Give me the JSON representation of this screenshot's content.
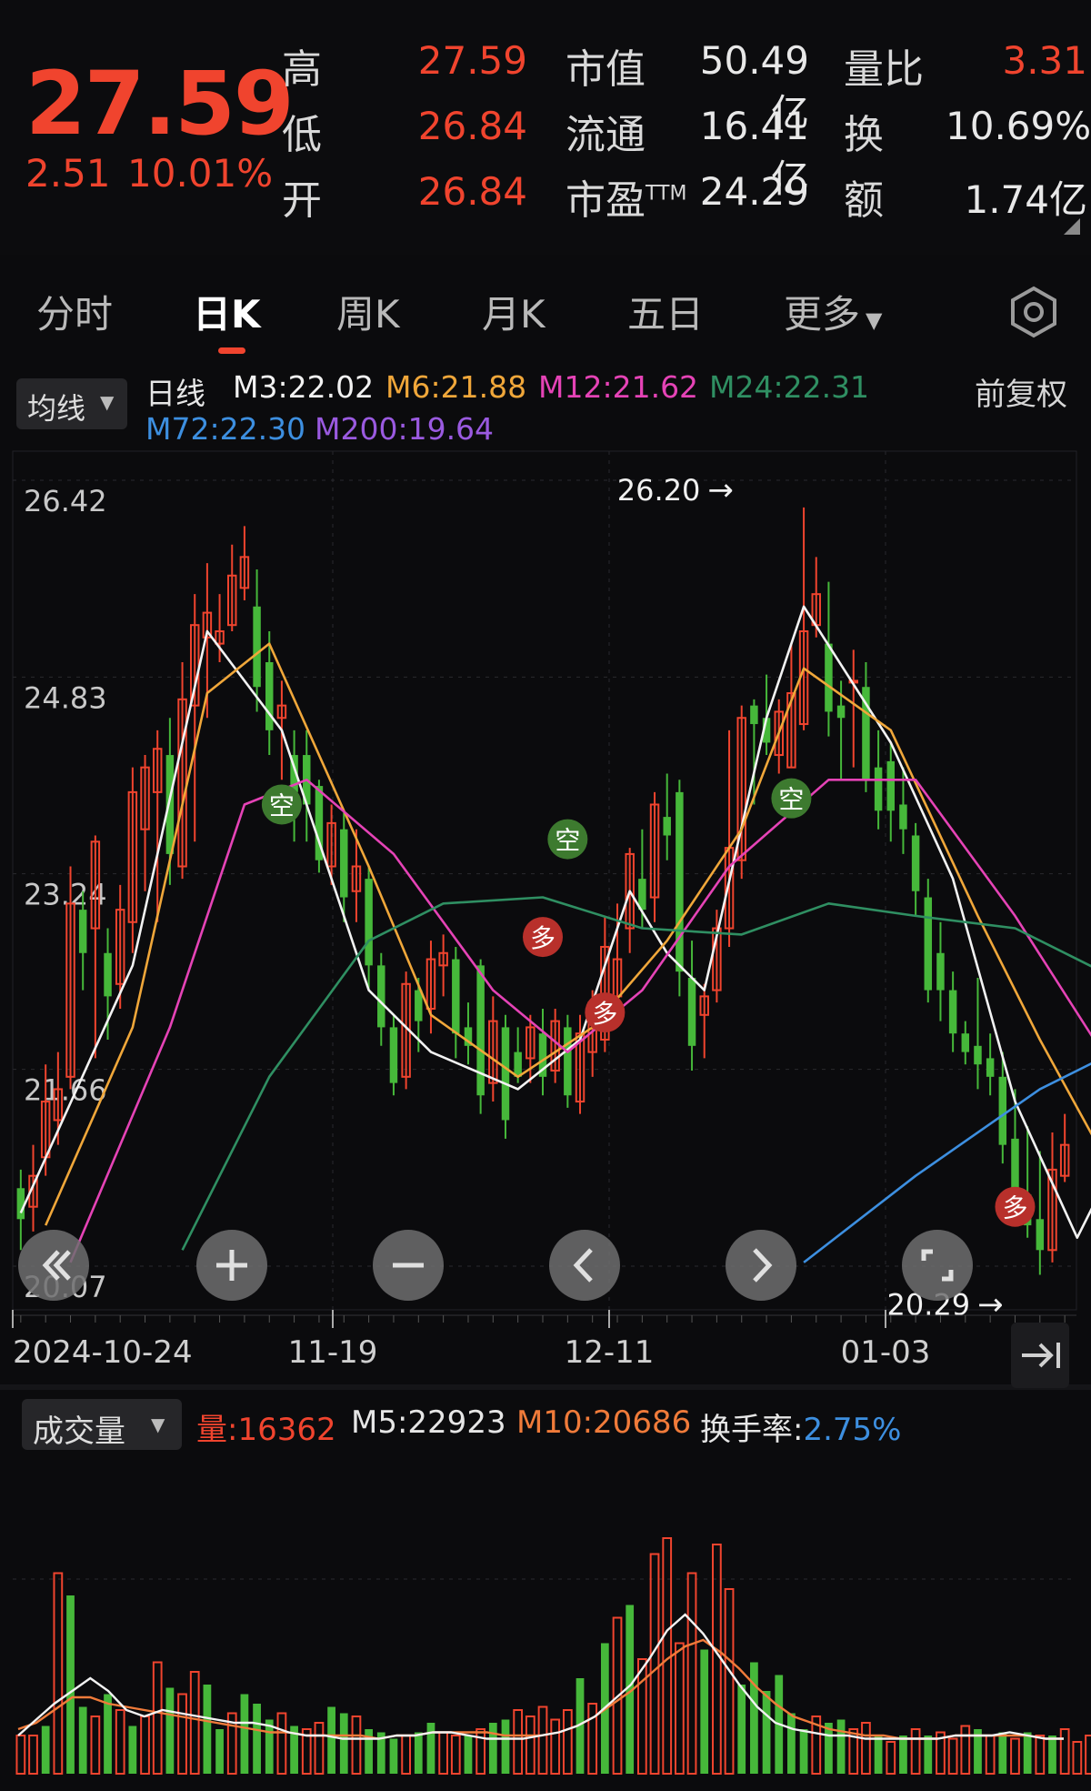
{
  "header": {
    "price": "27.59",
    "change_abs": "2.51",
    "change_pct": "10.01%",
    "stats": [
      {
        "label": "高",
        "value": "27.59",
        "red": true
      },
      {
        "label": "低",
        "value": "26.84",
        "red": true
      },
      {
        "label": "开",
        "value": "26.84",
        "red": true
      }
    ],
    "mid_stats": [
      {
        "label": "市值",
        "value": "50.49亿"
      },
      {
        "label": "流通",
        "value": "16.41亿"
      },
      {
        "label": "市盈",
        "sup": "TTM",
        "value": "24.29"
      }
    ],
    "right_stats": [
      {
        "label": "量比",
        "value": "3.31",
        "red": true
      },
      {
        "label": "换",
        "value": "10.69%"
      },
      {
        "label": "额",
        "value": "1.74亿"
      }
    ]
  },
  "tabs": [
    "分时",
    "日K",
    "周K",
    "月K",
    "五日",
    "更多"
  ],
  "active_tab": "日K",
  "ma_legend": {
    "selector": "均线",
    "line_label": "日线",
    "items": [
      {
        "text": "M3:22.02",
        "color": "#f2f2f2"
      },
      {
        "text": "M6:21.88",
        "color": "#f0a73a"
      },
      {
        "text": "M12:21.62",
        "color": "#e543b6"
      },
      {
        "text": "M24:22.31",
        "color": "#2f8f62"
      },
      {
        "text": "M72:22.30",
        "color": "#3d8fe0"
      },
      {
        "text": "M200:19.64",
        "color": "#9a5ae0"
      }
    ],
    "adjust": "前复权"
  },
  "chart_data": {
    "type": "candlestick",
    "y_ticks": [
      "26.42",
      "24.83",
      "23.24",
      "21.66",
      "20.07"
    ],
    "x_ticks": [
      "2024-10-24",
      "11-19",
      "12-11",
      "01-03"
    ],
    "ylim": [
      20.07,
      26.42
    ],
    "annotations": {
      "high": "26.20",
      "low": "20.29",
      "arrow": "→"
    },
    "signals": [
      {
        "label": "空",
        "index": 21,
        "price": 23.8,
        "kind": "sell"
      },
      {
        "label": "空",
        "index": 44,
        "price": 23.52,
        "kind": "sell"
      },
      {
        "label": "空",
        "index": 62,
        "price": 23.85,
        "kind": "sell"
      },
      {
        "label": "多",
        "index": 42,
        "price": 22.73,
        "kind": "buy"
      },
      {
        "label": "多",
        "index": 47,
        "price": 22.12,
        "kind": "buy"
      },
      {
        "label": "多",
        "index": 80,
        "price": 20.55,
        "kind": "buy"
      }
    ],
    "candles": [
      [
        20.7,
        20.45,
        20.85,
        20.2
      ],
      [
        20.55,
        20.8,
        21.05,
        20.35
      ],
      [
        20.95,
        21.4,
        21.7,
        20.8
      ],
      [
        21.25,
        21.5,
        21.8,
        21.05
      ],
      [
        21.6,
        23.0,
        23.3,
        21.5
      ],
      [
        22.95,
        22.6,
        23.1,
        22.3
      ],
      [
        22.8,
        23.5,
        23.55,
        21.75
      ],
      [
        22.6,
        22.25,
        22.8,
        21.9
      ],
      [
        22.35,
        22.95,
        23.15,
        22.15
      ],
      [
        22.85,
        23.9,
        24.1,
        22.6
      ],
      [
        23.6,
        24.1,
        24.2,
        23.1
      ],
      [
        23.9,
        24.25,
        24.4,
        22.85
      ],
      [
        24.2,
        23.4,
        24.5,
        23.15
      ],
      [
        23.3,
        24.65,
        24.95,
        23.2
      ],
      [
        24.6,
        25.25,
        25.5,
        23.5
      ],
      [
        25.15,
        25.35,
        25.75,
        24.5
      ],
      [
        25.1,
        25.2,
        25.5,
        24.95
      ],
      [
        25.25,
        25.65,
        25.9,
        25.2
      ],
      [
        25.55,
        25.8,
        26.05,
        25.45
      ],
      [
        25.4,
        24.75,
        25.7,
        24.55
      ],
      [
        24.95,
        24.4,
        25.2,
        24.2
      ],
      [
        24.5,
        24.6,
        24.8,
        24.0
      ],
      [
        24.2,
        23.9,
        24.4,
        23.5
      ],
      [
        24.2,
        23.8,
        24.4,
        23.5
      ],
      [
        23.95,
        23.35,
        24.0,
        23.25
      ],
      [
        23.3,
        23.65,
        23.8,
        23.15
      ],
      [
        23.6,
        23.05,
        23.75,
        22.85
      ],
      [
        23.1,
        23.3,
        23.6,
        22.85
      ],
      [
        23.2,
        22.5,
        23.3,
        22.3
      ],
      [
        22.5,
        22.0,
        22.6,
        21.85
      ],
      [
        22.0,
        21.55,
        22.1,
        21.45
      ],
      [
        21.6,
        22.35,
        22.45,
        21.5
      ],
      [
        22.3,
        22.05,
        22.4,
        21.8
      ],
      [
        22.15,
        22.55,
        22.7,
        21.95
      ],
      [
        22.5,
        22.6,
        22.75,
        22.25
      ],
      [
        22.55,
        21.95,
        22.65,
        21.75
      ],
      [
        22.0,
        21.85,
        22.2,
        21.7
      ],
      [
        22.5,
        21.45,
        22.55,
        21.3
      ],
      [
        21.55,
        22.05,
        22.25,
        21.4
      ],
      [
        22.0,
        21.25,
        22.1,
        21.1
      ],
      [
        21.8,
        21.6,
        22.0,
        21.55
      ],
      [
        21.75,
        22.0,
        22.1,
        21.55
      ],
      [
        21.95,
        21.6,
        22.15,
        21.45
      ],
      [
        21.65,
        22.05,
        22.15,
        21.55
      ],
      [
        22.0,
        21.45,
        22.1,
        21.35
      ],
      [
        21.4,
        21.95,
        22.1,
        21.3
      ],
      [
        21.8,
        22.2,
        22.3,
        21.6
      ],
      [
        21.9,
        22.65,
        22.9,
        21.8
      ],
      [
        22.25,
        22.55,
        23.0,
        22.2
      ],
      [
        22.8,
        23.4,
        23.45,
        22.6
      ],
      [
        23.2,
        22.95,
        23.6,
        22.8
      ],
      [
        23.05,
        23.8,
        23.9,
        22.85
      ],
      [
        23.7,
        23.55,
        24.05,
        23.35
      ],
      [
        23.9,
        22.45,
        24.0,
        22.25
      ],
      [
        22.4,
        21.85,
        22.7,
        21.65
      ],
      [
        22.1,
        22.25,
        22.35,
        21.75
      ],
      [
        22.3,
        22.8,
        22.95,
        22.2
      ],
      [
        22.8,
        23.45,
        24.4,
        22.65
      ],
      [
        23.35,
        24.5,
        24.6,
        23.2
      ],
      [
        24.6,
        24.45,
        24.65,
        23.8
      ],
      [
        24.5,
        24.3,
        24.85,
        24.2
      ],
      [
        24.2,
        24.55,
        24.65,
        24.05
      ],
      [
        24.1,
        24.7,
        25.1,
        24.1
      ],
      [
        24.45,
        25.2,
        26.2,
        24.4
      ],
      [
        25.25,
        25.5,
        25.8,
        25.15
      ],
      [
        25.1,
        24.55,
        25.6,
        24.35
      ],
      [
        24.6,
        24.5,
        24.8,
        24.0
      ],
      [
        24.8,
        24.8,
        25.05,
        24.1
      ],
      [
        24.75,
        24.0,
        24.95,
        23.9
      ],
      [
        24.1,
        23.75,
        24.4,
        23.6
      ],
      [
        24.15,
        23.75,
        24.3,
        23.5
      ],
      [
        23.8,
        23.6,
        24.1,
        23.4
      ],
      [
        23.55,
        23.1,
        23.65,
        22.9
      ],
      [
        23.05,
        22.3,
        23.2,
        22.2
      ],
      [
        22.6,
        22.3,
        22.85,
        22.05
      ],
      [
        22.3,
        21.95,
        22.45,
        21.8
      ],
      [
        21.95,
        21.8,
        22.05,
        21.7
      ],
      [
        21.85,
        21.7,
        22.4,
        21.5
      ],
      [
        21.75,
        21.6,
        21.95,
        21.45
      ],
      [
        21.6,
        21.05,
        21.8,
        20.9
      ],
      [
        21.1,
        20.6,
        21.5,
        20.5
      ],
      [
        20.65,
        20.4,
        21.2,
        20.3
      ],
      [
        20.45,
        20.2,
        21.0,
        20.0
      ],
      [
        20.2,
        20.85,
        21.15,
        20.1
      ],
      [
        20.8,
        21.05,
        21.3,
        20.75
      ]
    ],
    "ma_lines": [
      {
        "name": "M3",
        "color": "#f2f2f2",
        "points": [
          [
            0,
            20.5
          ],
          [
            9,
            22.5
          ],
          [
            15,
            25.2
          ],
          [
            21,
            24.4
          ],
          [
            28,
            22.3
          ],
          [
            33,
            21.8
          ],
          [
            40,
            21.5
          ],
          [
            45,
            21.9
          ],
          [
            49,
            23.1
          ],
          [
            52,
            22.6
          ],
          [
            55,
            22.3
          ],
          [
            60,
            24.5
          ],
          [
            63,
            25.4
          ],
          [
            70,
            24.3
          ],
          [
            75,
            23.2
          ],
          [
            80,
            21.4
          ],
          [
            85,
            20.3
          ],
          [
            88,
            20.9
          ],
          [
            92,
            21.2
          ],
          [
            96,
            21.8
          ],
          [
            99,
            21.6
          ]
        ]
      },
      {
        "name": "M6",
        "color": "#f0a73a",
        "points": [
          [
            2,
            20.4
          ],
          [
            9,
            22.0
          ],
          [
            15,
            24.7
          ],
          [
            20,
            25.1
          ],
          [
            28,
            23.3
          ],
          [
            33,
            22.1
          ],
          [
            40,
            21.6
          ],
          [
            46,
            22.0
          ],
          [
            52,
            22.7
          ],
          [
            58,
            23.6
          ],
          [
            63,
            24.9
          ],
          [
            70,
            24.4
          ],
          [
            77,
            22.9
          ],
          [
            82,
            21.9
          ],
          [
            88,
            20.8
          ],
          [
            92,
            21.0
          ],
          [
            99,
            21.3
          ]
        ]
      },
      {
        "name": "M12",
        "color": "#e543b6",
        "points": [
          [
            4,
            20.1
          ],
          [
            12,
            22.0
          ],
          [
            18,
            23.8
          ],
          [
            23,
            24.0
          ],
          [
            30,
            23.4
          ],
          [
            38,
            22.3
          ],
          [
            44,
            21.8
          ],
          [
            50,
            22.3
          ],
          [
            57,
            23.3
          ],
          [
            65,
            24.0
          ],
          [
            72,
            24.0
          ],
          [
            80,
            22.9
          ],
          [
            87,
            21.8
          ],
          [
            92,
            21.5
          ],
          [
            99,
            21.3
          ]
        ]
      },
      {
        "name": "M24",
        "color": "#2f8f62",
        "points": [
          [
            13,
            20.2
          ],
          [
            20,
            21.6
          ],
          [
            28,
            22.7
          ],
          [
            34,
            23.0
          ],
          [
            42,
            23.05
          ],
          [
            50,
            22.8
          ],
          [
            58,
            22.75
          ],
          [
            65,
            23.0
          ],
          [
            72,
            22.9
          ],
          [
            80,
            22.8
          ],
          [
            88,
            22.4
          ],
          [
            95,
            22.0
          ],
          [
            99,
            21.7
          ]
        ]
      },
      {
        "name": "M72",
        "color": "#3d8fe0",
        "points": [
          [
            63,
            20.1
          ],
          [
            72,
            20.8
          ],
          [
            82,
            21.5
          ],
          [
            90,
            21.9
          ],
          [
            96,
            22.2
          ],
          [
            99,
            22.3
          ]
        ]
      }
    ],
    "volume_legend": {
      "selector": "成交量",
      "vol": "量:16362",
      "m5": "M5:22923",
      "m10": "M10:20686",
      "turnover_label": "换手率:",
      "turnover": "2.75%"
    },
    "volume": [
      [
        0.12,
        1
      ],
      [
        0.12,
        1
      ],
      [
        0.15,
        0
      ],
      [
        0.63,
        1
      ],
      [
        0.56,
        0
      ],
      [
        0.21,
        0
      ],
      [
        0.18,
        1
      ],
      [
        0.25,
        0
      ],
      [
        0.2,
        1
      ],
      [
        0.15,
        0
      ],
      [
        0.18,
        1
      ],
      [
        0.35,
        1
      ],
      [
        0.27,
        0
      ],
      [
        0.25,
        1
      ],
      [
        0.32,
        1
      ],
      [
        0.28,
        0
      ],
      [
        0.14,
        0
      ],
      [
        0.19,
        1
      ],
      [
        0.25,
        0
      ],
      [
        0.22,
        0
      ],
      [
        0.17,
        0
      ],
      [
        0.19,
        1
      ],
      [
        0.15,
        0
      ],
      [
        0.14,
        1
      ],
      [
        0.16,
        1
      ],
      [
        0.21,
        0
      ],
      [
        0.19,
        0
      ],
      [
        0.18,
        1
      ],
      [
        0.14,
        0
      ],
      [
        0.13,
        0
      ],
      [
        0.11,
        0
      ],
      [
        0.12,
        1
      ],
      [
        0.13,
        0
      ],
      [
        0.16,
        0
      ],
      [
        0.13,
        1
      ],
      [
        0.12,
        1
      ],
      [
        0.12,
        0
      ],
      [
        0.14,
        1
      ],
      [
        0.16,
        0
      ],
      [
        0.17,
        0
      ],
      [
        0.2,
        1
      ],
      [
        0.18,
        1
      ],
      [
        0.21,
        1
      ],
      [
        0.17,
        1
      ],
      [
        0.2,
        1
      ],
      [
        0.3,
        0
      ],
      [
        0.22,
        1
      ],
      [
        0.41,
        0
      ],
      [
        0.49,
        1
      ],
      [
        0.53,
        0
      ],
      [
        0.36,
        1
      ],
      [
        0.69,
        1
      ],
      [
        0.74,
        1
      ],
      [
        0.41,
        1
      ],
      [
        0.63,
        1
      ],
      [
        0.39,
        0
      ],
      [
        0.72,
        1
      ],
      [
        0.58,
        1
      ],
      [
        0.28,
        0
      ],
      [
        0.35,
        0
      ],
      [
        0.26,
        0
      ],
      [
        0.31,
        0
      ],
      [
        0.19,
        0
      ],
      [
        0.14,
        0
      ],
      [
        0.18,
        1
      ],
      [
        0.16,
        0
      ],
      [
        0.17,
        0
      ],
      [
        0.14,
        1
      ],
      [
        0.16,
        1
      ],
      [
        0.12,
        0
      ],
      [
        0.1,
        1
      ],
      [
        0.12,
        0
      ],
      [
        0.14,
        1
      ],
      [
        0.12,
        0
      ],
      [
        0.13,
        1
      ],
      [
        0.11,
        1
      ],
      [
        0.15,
        1
      ],
      [
        0.14,
        0
      ],
      [
        0.12,
        1
      ],
      [
        0.13,
        0
      ],
      [
        0.11,
        1
      ],
      [
        0.13,
        0
      ],
      [
        0.12,
        1
      ],
      [
        0.12,
        0
      ],
      [
        0.14,
        1
      ],
      [
        0.1,
        1
      ],
      [
        0.12,
        1
      ],
      [
        0.13,
        0
      ],
      [
        0.12,
        1
      ],
      [
        0.16,
        1
      ],
      [
        0.18,
        1
      ],
      [
        0.14,
        1
      ],
      [
        0.13,
        1
      ],
      [
        0.11,
        1
      ],
      [
        0.1,
        1
      ],
      [
        0.12,
        1
      ],
      [
        0.11,
        0
      ],
      [
        0.11,
        1
      ],
      [
        0.1,
        1
      ],
      [
        0.1,
        1
      ]
    ],
    "vol_m5": [
      0.12,
      0.17,
      0.22,
      0.26,
      0.3,
      0.26,
      0.2,
      0.18,
      0.2,
      0.19,
      0.18,
      0.17,
      0.16,
      0.16,
      0.15,
      0.13,
      0.12,
      0.12,
      0.11,
      0.11,
      0.11,
      0.12,
      0.12,
      0.13,
      0.13,
      0.12,
      0.11,
      0.11,
      0.11,
      0.12,
      0.13,
      0.15,
      0.18,
      0.23,
      0.28,
      0.36,
      0.45,
      0.5,
      0.44,
      0.36,
      0.28,
      0.21,
      0.16,
      0.14,
      0.13,
      0.12,
      0.12,
      0.11,
      0.11,
      0.11,
      0.11,
      0.11,
      0.12,
      0.12,
      0.12,
      0.13,
      0.12,
      0.11,
      0.11
    ],
    "vol_m10": [
      0.14,
      0.16,
      0.2,
      0.24,
      0.24,
      0.22,
      0.21,
      0.2,
      0.19,
      0.18,
      0.17,
      0.16,
      0.15,
      0.14,
      0.13,
      0.13,
      0.12,
      0.12,
      0.12,
      0.12,
      0.11,
      0.12,
      0.12,
      0.13,
      0.13,
      0.13,
      0.13,
      0.12,
      0.12,
      0.12,
      0.13,
      0.15,
      0.18,
      0.22,
      0.26,
      0.31,
      0.36,
      0.4,
      0.42,
      0.38,
      0.33,
      0.27,
      0.22,
      0.18,
      0.16,
      0.14,
      0.13,
      0.12,
      0.12,
      0.11,
      0.11,
      0.11,
      0.12,
      0.12,
      0.12,
      0.12,
      0.12,
      0.11,
      0.11
    ]
  },
  "colors": {
    "up": "#f0442e",
    "down": "#46b83a",
    "grid": "#2a2a2e",
    "bg": "#0b0b0d"
  }
}
